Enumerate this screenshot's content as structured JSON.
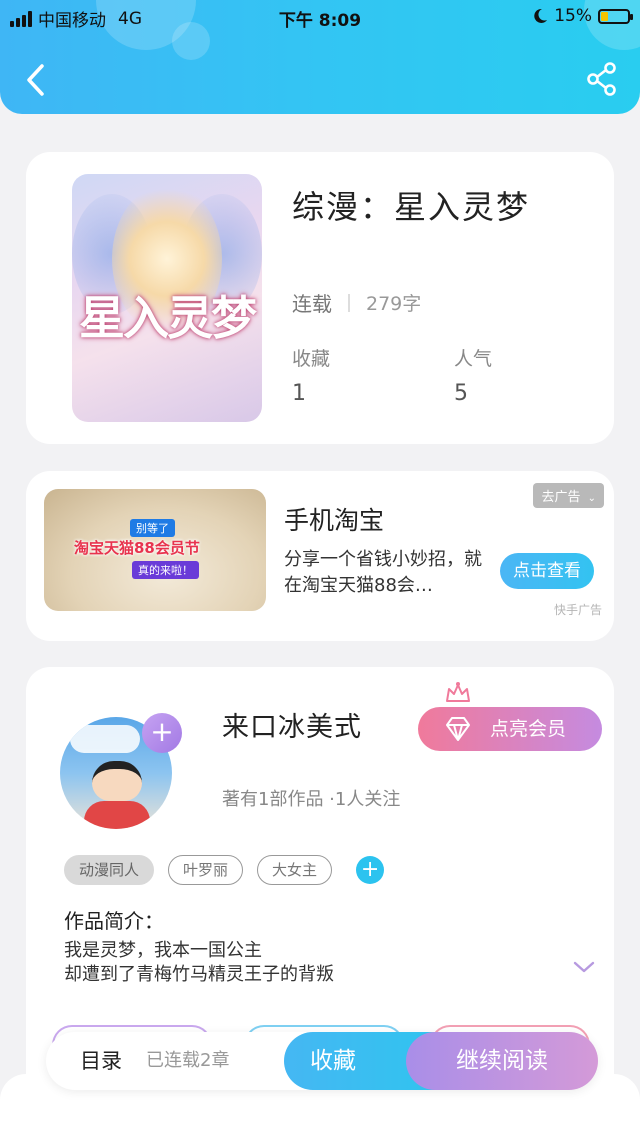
{
  "status_bar": {
    "carrier": "中国移动",
    "network": "4G",
    "time": "下午 8:09",
    "battery": "15%"
  },
  "header": {
    "back_icon": "chevron-left-icon",
    "share_icon": "share-icon"
  },
  "book": {
    "cover_title": "星入灵梦",
    "title": "综漫：星入灵梦",
    "status": "连载",
    "word_count": "279字",
    "favorites_label": "收藏",
    "favorites_value": "1",
    "popularity_label": "人气",
    "popularity_value": "5"
  },
  "ad": {
    "image_line1": "别等了",
    "image_line2": "淘宝天猫88会员节",
    "image_line3": "真的来啦！",
    "title": "手机淘宝",
    "description": "分享一个省钱小妙招，就在淘宝天猫88会…",
    "tag": "去广告",
    "button": "点击查看",
    "source": "快手广告"
  },
  "author": {
    "name": "来口冰美式",
    "vip_button": "点亮会员",
    "works": "著有1部作品 ·1人关注",
    "tags": [
      "动漫同人",
      "叶罗丽",
      "大女主"
    ],
    "intro_heading": "作品简介：",
    "intro_line1": "我是灵梦，我本一国公主",
    "intro_line2": "却遭到了青梅竹马精灵王子的背叛"
  },
  "bottom_bar": {
    "toc": "目录",
    "chapters": "已连载2章",
    "favorite": "收藏",
    "continue": "继续阅读"
  },
  "colors": {
    "header": "#33c5f3",
    "accent_blue": "#2cc3ef",
    "accent_purple": "#a98ee8",
    "vip_pink": "#f07a9b"
  }
}
